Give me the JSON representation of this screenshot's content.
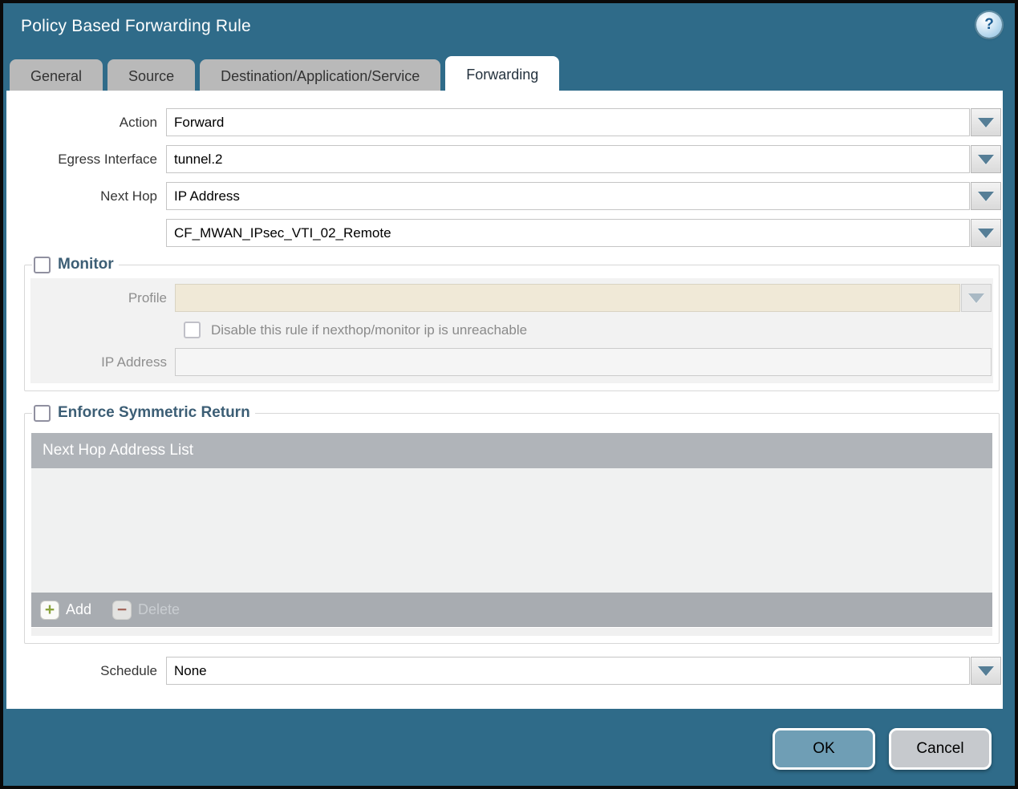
{
  "dialog": {
    "title": "Policy Based Forwarding Rule",
    "help_glyph": "?"
  },
  "tabs": [
    {
      "label": "General",
      "active": false
    },
    {
      "label": "Source",
      "active": false
    },
    {
      "label": "Destination/Application/Service",
      "active": false
    },
    {
      "label": "Forwarding",
      "active": true
    }
  ],
  "form": {
    "action": {
      "label": "Action",
      "value": "Forward"
    },
    "egress_interface": {
      "label": "Egress Interface",
      "value": "tunnel.2"
    },
    "next_hop": {
      "label": "Next Hop",
      "value": "IP Address",
      "address_value": "CF_MWAN_IPsec_VTI_02_Remote"
    },
    "schedule": {
      "label": "Schedule",
      "value": "None"
    }
  },
  "monitor": {
    "legend": "Monitor",
    "checked": false,
    "profile": {
      "label": "Profile",
      "value": ""
    },
    "disable_rule_label": "Disable this rule if nexthop/monitor ip is unreachable",
    "ip_address": {
      "label": "IP Address",
      "value": ""
    }
  },
  "symmetric_return": {
    "legend": "Enforce Symmetric Return",
    "checked": false,
    "table": {
      "header": "Next Hop Address List",
      "rows": [],
      "add_label": "Add",
      "delete_label": "Delete"
    }
  },
  "footer": {
    "ok_label": "OK",
    "cancel_label": "Cancel"
  },
  "colors": {
    "titlebar_teal": "#2f6b89",
    "active_tab_bg": "#ffffff",
    "inactive_tab_bg": "#b9b9b9",
    "legend_text": "#3c5e75",
    "profile_field_cream": "#f0e9d7",
    "table_header_bg": "#b0b4b9",
    "ok_button_bg": "#6f9eb5",
    "cancel_button_bg": "#c6c9cd"
  }
}
